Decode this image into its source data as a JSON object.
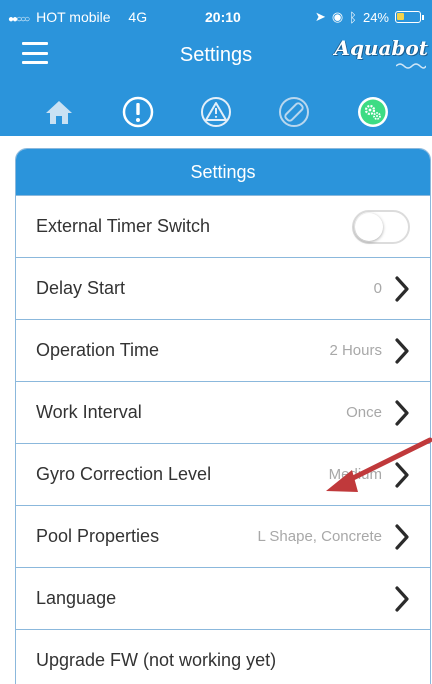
{
  "status_bar": {
    "signal_dots": "●●○○○",
    "carrier": "HOT mobile",
    "network": "4G",
    "time": "20:10",
    "battery_percent": "24%",
    "battery_level": 0.24
  },
  "nav": {
    "title": "Settings",
    "logo_text": "Aquabot",
    "menu_icon": "hamburger-menu-icon"
  },
  "tabs": [
    {
      "icon": "home-icon",
      "active": false
    },
    {
      "icon": "alert-circle-icon",
      "active": false
    },
    {
      "icon": "warning-triangle-icon",
      "active": false
    },
    {
      "icon": "remote-control-icon",
      "active": false
    },
    {
      "icon": "settings-gears-icon",
      "active": true
    }
  ],
  "card": {
    "title": "Settings",
    "rows": [
      {
        "label": "External Timer Switch",
        "control": "toggle",
        "toggle_on": false
      },
      {
        "label": "Delay Start",
        "value": "0",
        "control": "chevron"
      },
      {
        "label": "Operation Time",
        "value": "2 Hours",
        "control": "chevron"
      },
      {
        "label": "Work Interval",
        "value": "Once",
        "control": "chevron"
      },
      {
        "label": "Gyro Correction Level",
        "value": "Medium",
        "control": "chevron"
      },
      {
        "label": "Pool Properties",
        "value": "L Shape, Concrete",
        "control": "chevron"
      },
      {
        "label": "Language",
        "value": "",
        "control": "chevron"
      },
      {
        "label": "Upgrade FW (not working yet)",
        "value": "",
        "control": "none"
      }
    ]
  },
  "colors": {
    "primary": "#2b94db",
    "border": "#8bb8dc",
    "active_tab": "#3ddc84",
    "annotation_arrow": "#c0393b"
  }
}
